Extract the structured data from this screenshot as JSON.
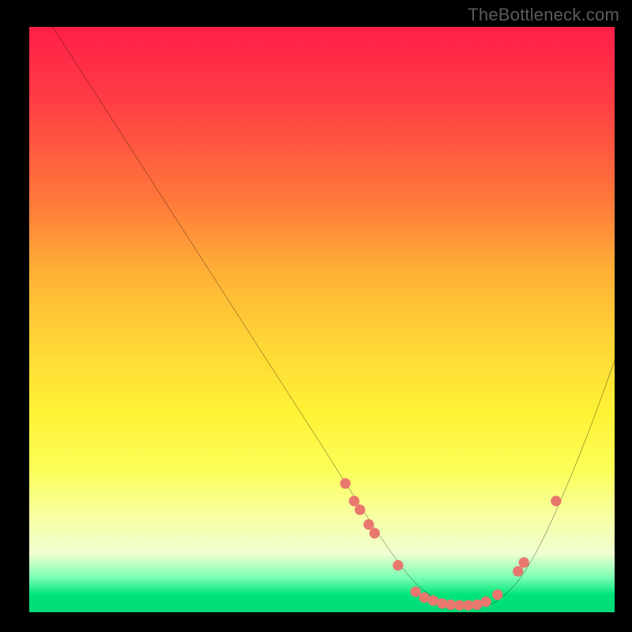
{
  "watermark": "TheBottleneck.com",
  "chart_data": {
    "type": "line",
    "title": "",
    "xlabel": "",
    "ylabel": "",
    "xlim": [
      0,
      100
    ],
    "ylim": [
      0,
      100
    ],
    "series": [
      {
        "name": "curve",
        "x": [
          4,
          13,
          22,
          31,
          40,
          49,
          56,
          62,
          66,
          70,
          74,
          77,
          80,
          84,
          88,
          92,
          96,
          100
        ],
        "y": [
          100,
          86,
          72,
          58,
          44,
          30,
          19,
          10,
          5,
          2,
          1,
          1,
          2,
          6,
          13,
          22,
          32,
          43
        ]
      }
    ],
    "markers": [
      {
        "x": 54,
        "y": 22
      },
      {
        "x": 55.5,
        "y": 19
      },
      {
        "x": 56.5,
        "y": 17.5
      },
      {
        "x": 58,
        "y": 15
      },
      {
        "x": 59,
        "y": 13.5
      },
      {
        "x": 63,
        "y": 8
      },
      {
        "x": 66,
        "y": 3.5
      },
      {
        "x": 67.5,
        "y": 2.5
      },
      {
        "x": 69,
        "y": 2
      },
      {
        "x": 70.5,
        "y": 1.5
      },
      {
        "x": 72,
        "y": 1.3
      },
      {
        "x": 73.5,
        "y": 1.2
      },
      {
        "x": 75,
        "y": 1.2
      },
      {
        "x": 76.5,
        "y": 1.3
      },
      {
        "x": 78,
        "y": 1.8
      },
      {
        "x": 80,
        "y": 3
      },
      {
        "x": 83.5,
        "y": 7
      },
      {
        "x": 84.5,
        "y": 8.5
      },
      {
        "x": 90,
        "y": 19
      }
    ],
    "marker_color": "#e8776e",
    "curve_color": "#000000",
    "gradient_stops": [
      {
        "pos": 0,
        "color": "#ff1f48"
      },
      {
        "pos": 30,
        "color": "#ff7a3a"
      },
      {
        "pos": 55,
        "color": "#ffd836"
      },
      {
        "pos": 84,
        "color": "#f7ffa6"
      },
      {
        "pos": 97,
        "color": "#00e57a"
      },
      {
        "pos": 100,
        "color": "#00d878"
      }
    ]
  }
}
